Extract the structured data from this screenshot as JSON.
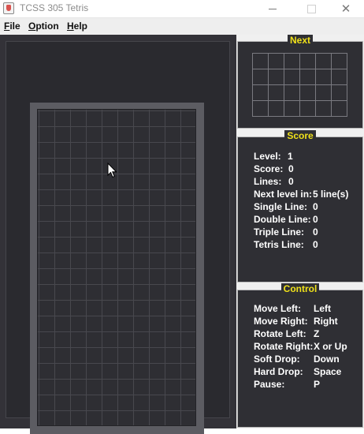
{
  "window": {
    "title": "TCSS 305 Tetris",
    "minimize_icon": "minimize-icon",
    "maximize_icon": "maximize-icon",
    "close_icon": "close-icon",
    "close_glyph": "✕"
  },
  "menu": {
    "file": {
      "first": "F",
      "rest": "ile"
    },
    "option": {
      "first": "O",
      "rest": "ption"
    },
    "help": {
      "first": "H",
      "rest": "elp"
    }
  },
  "board": {
    "columns": 10,
    "rows": 20,
    "empty_color": "#2e2e33",
    "grid_color": "#48484e"
  },
  "next_panel": {
    "title": "Next",
    "columns": 6,
    "rows": 4
  },
  "score_panel": {
    "title": "Score",
    "rows": [
      {
        "label": "Level:",
        "value": "1"
      },
      {
        "label": "Score:",
        "value": "0"
      },
      {
        "label": "Lines:",
        "value": "0"
      },
      {
        "label": "Next level in:",
        "value": "5 line(s)"
      },
      {
        "label": "Single Line:",
        "value": "0"
      },
      {
        "label": "Double Line:",
        "value": "0"
      },
      {
        "label": "Triple Line:",
        "value": "0"
      },
      {
        "label": "Tetris Line:",
        "value": "0"
      }
    ]
  },
  "control_panel": {
    "title": "Control",
    "rows": [
      {
        "label": "Move Left:",
        "value": "Left"
      },
      {
        "label": "Move Right:",
        "value": "Right"
      },
      {
        "label": "Rotate Left:",
        "value": "Z"
      },
      {
        "label": "Rotate Right:",
        "value": "X or Up"
      },
      {
        "label": "Soft Drop:",
        "value": "Down"
      },
      {
        "label": "Hard Drop:",
        "value": "Space"
      },
      {
        "label": "Pause:",
        "value": "P"
      }
    ]
  },
  "colors": {
    "panel_title": "#f0e11a",
    "panel_bg": "#2f2f34",
    "game_bg": "#333238"
  }
}
